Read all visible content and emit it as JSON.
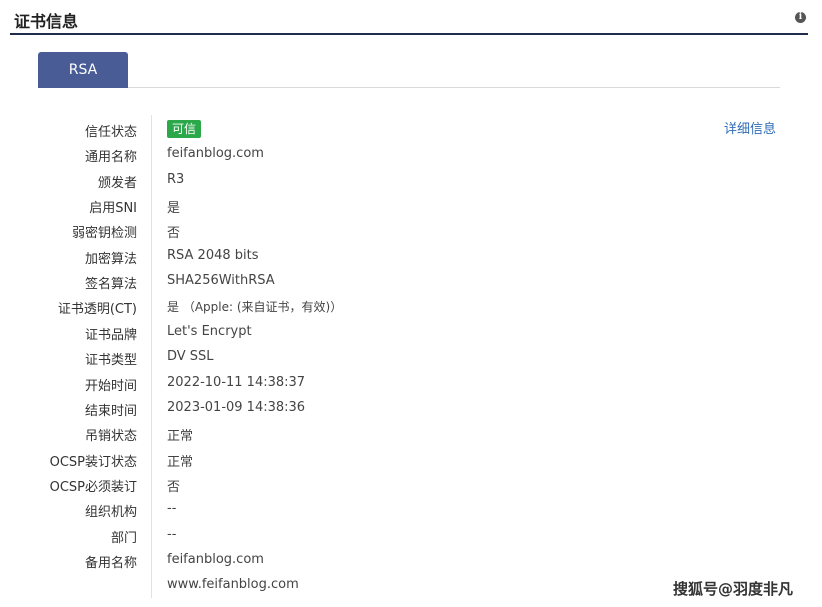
{
  "header": {
    "title": "证书信息",
    "info_icon": "info-icon"
  },
  "tabs": [
    {
      "label": "RSA",
      "active": true
    }
  ],
  "details_link": "详细信息",
  "rows": [
    {
      "label": "信任状态",
      "value": "可信",
      "badge": true,
      "badge_color": "#2aa84a"
    },
    {
      "label": "通用名称",
      "value": "feifanblog.com"
    },
    {
      "label": "颁发者",
      "value": "R3"
    },
    {
      "label": "启用SNI",
      "value": "是"
    },
    {
      "label": "弱密钥检测",
      "value": "否"
    },
    {
      "label": "加密算法",
      "value": "RSA 2048 bits"
    },
    {
      "label": "签名算法",
      "value": "SHA256WithRSA"
    },
    {
      "label": "证书透明(CT)",
      "value": "是 （Apple: (来自证书，有效)）"
    },
    {
      "label": "证书品牌",
      "value": "Let's Encrypt"
    },
    {
      "label": "证书类型",
      "value": "DV SSL"
    },
    {
      "label": "开始时间",
      "value": "2022-10-11 14:38:37"
    },
    {
      "label": "结束时间",
      "value": "2023-01-09 14:38:36"
    },
    {
      "label": "吊销状态",
      "value": "正常"
    },
    {
      "label": "OCSP装订状态",
      "value": "正常"
    },
    {
      "label": "OCSP必须装订",
      "value": "否"
    },
    {
      "label": "组织机构",
      "value": "--"
    },
    {
      "label": "部门",
      "value": "--"
    },
    {
      "label": "备用名称",
      "value": "feifanblog.com"
    },
    {
      "label": "",
      "value": "www.feifanblog.com"
    }
  ],
  "watermark": "搜狐号@羽度非凡"
}
